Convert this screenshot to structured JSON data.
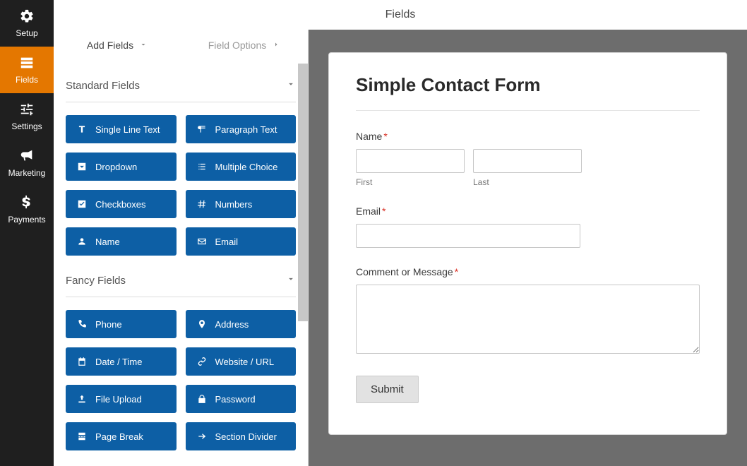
{
  "header": {
    "title": "Fields"
  },
  "nav": [
    {
      "id": "setup",
      "label": "Setup",
      "icon": "gear-icon"
    },
    {
      "id": "fields",
      "label": "Fields",
      "icon": "list-icon",
      "active": true
    },
    {
      "id": "settings",
      "label": "Settings",
      "icon": "sliders-icon"
    },
    {
      "id": "marketing",
      "label": "Marketing",
      "icon": "bullhorn-icon"
    },
    {
      "id": "payments",
      "label": "Payments",
      "icon": "dollar-icon"
    }
  ],
  "tabs": {
    "add_fields": "Add Fields",
    "field_options": "Field Options"
  },
  "sections": {
    "standard": {
      "title": "Standard Fields",
      "items": [
        {
          "id": "single_line",
          "label": "Single Line Text",
          "icon": "text-cursor-icon"
        },
        {
          "id": "paragraph",
          "label": "Paragraph Text",
          "icon": "paragraph-icon"
        },
        {
          "id": "dropdown",
          "label": "Dropdown",
          "icon": "chevron-square-icon"
        },
        {
          "id": "multiple_choice",
          "label": "Multiple Choice",
          "icon": "list-ul-icon"
        },
        {
          "id": "checkboxes",
          "label": "Checkboxes",
          "icon": "check-square-icon"
        },
        {
          "id": "numbers",
          "label": "Numbers",
          "icon": "hash-icon"
        },
        {
          "id": "name",
          "label": "Name",
          "icon": "user-icon"
        },
        {
          "id": "email",
          "label": "Email",
          "icon": "envelope-icon"
        }
      ]
    },
    "fancy": {
      "title": "Fancy Fields",
      "items": [
        {
          "id": "phone",
          "label": "Phone",
          "icon": "phone-icon"
        },
        {
          "id": "address",
          "label": "Address",
          "icon": "map-pin-icon"
        },
        {
          "id": "datetime",
          "label": "Date / Time",
          "icon": "calendar-icon"
        },
        {
          "id": "url",
          "label": "Website / URL",
          "icon": "link-icon"
        },
        {
          "id": "file_upload",
          "label": "File Upload",
          "icon": "upload-icon"
        },
        {
          "id": "password",
          "label": "Password",
          "icon": "lock-icon"
        },
        {
          "id": "page_break",
          "label": "Page Break",
          "icon": "page-break-icon"
        },
        {
          "id": "section_div",
          "label": "Section Divider",
          "icon": "arrow-right-icon"
        }
      ]
    }
  },
  "form": {
    "title": "Simple Contact Form",
    "fields": {
      "name": {
        "label": "Name",
        "required": true,
        "first_sub": "First",
        "last_sub": "Last"
      },
      "email": {
        "label": "Email",
        "required": true
      },
      "comment": {
        "label": "Comment or Message",
        "required": true
      }
    },
    "submit": "Submit"
  }
}
